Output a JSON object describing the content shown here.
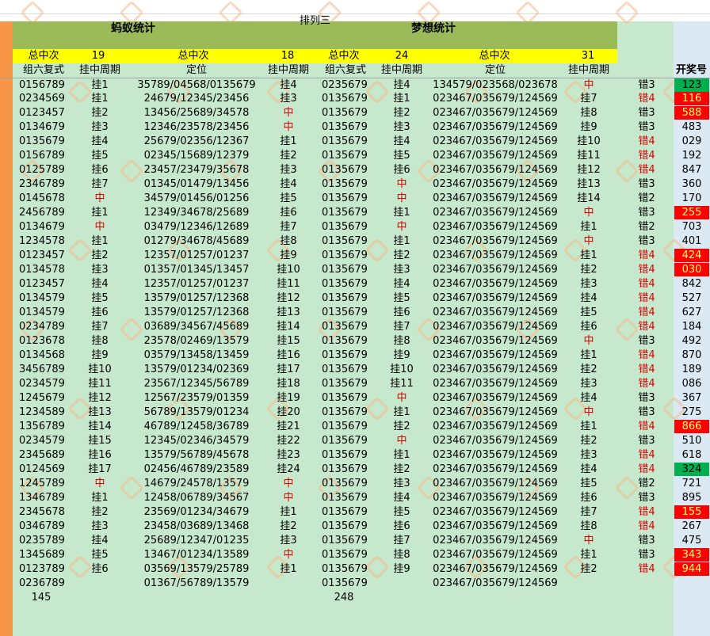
{
  "sheet": {
    "title_left": "蚂蚁统计",
    "title_right": "梦想统计",
    "subtitle": "排列三"
  },
  "summary": {
    "l1_label": "总中次",
    "l1_value": "19",
    "l2_label": "总中次",
    "l2_value": "18",
    "r1_label": "总中次",
    "r1_value": "24",
    "r2_label": "总中次",
    "r2_value": "31"
  },
  "headers": {
    "h1": "组六复式",
    "h2": "挂中周期",
    "h3": "定位",
    "h4": "挂中周期",
    "h5": "组六复式",
    "h6": "挂中周期",
    "h7": "定位",
    "h8": "挂中周期",
    "h9": "开奖号"
  },
  "rows": [
    {
      "a": "0156789",
      "b": "挂1",
      "c": "35789/04568/0135679",
      "d": "挂4",
      "e": "0235679",
      "f": "挂4",
      "g": "134579/023568/023678",
      "h": "中",
      "i": "错3",
      "j": "123",
      "jc": "green"
    },
    {
      "a": "0234569",
      "b": "挂1",
      "c": "24679/12345/23456",
      "d": "挂3",
      "e": "0135679",
      "f": "挂1",
      "g": "023467/035679/124569",
      "h": "挂7",
      "i": "错4",
      "j": "116",
      "jc": "red"
    },
    {
      "a": "0123457",
      "b": "挂2",
      "c": "13456/25689/34578",
      "d": "中",
      "e": "0135679",
      "f": "挂2",
      "g": "023467/035679/124569",
      "h": "挂8",
      "i": "错3",
      "j": "588",
      "jc": "red"
    },
    {
      "a": "0134679",
      "b": "挂3",
      "c": "12346/23578/23456",
      "d": "中",
      "e": "0135679",
      "f": "挂3",
      "g": "023467/035679/124569",
      "h": "挂9",
      "i": "错3",
      "j": "483",
      "jc": ""
    },
    {
      "a": "0135679",
      "b": "挂4",
      "c": "25679/02356/12367",
      "d": "挂1",
      "e": "0135679",
      "f": "挂4",
      "g": "023467/035679/124569",
      "h": "挂10",
      "i": "错4",
      "j": "029",
      "jc": ""
    },
    {
      "a": "0156789",
      "b": "挂5",
      "c": "02345/15689/12379",
      "d": "挂2",
      "e": "0135679",
      "f": "挂5",
      "g": "023467/035679/124569",
      "h": "挂11",
      "i": "错4",
      "j": "192",
      "jc": ""
    },
    {
      "a": "0125789",
      "b": "挂6",
      "c": "23457/23479/35678",
      "d": "挂3",
      "e": "0135679",
      "f": "挂6",
      "g": "023467/035679/124569",
      "h": "挂12",
      "i": "错4",
      "j": "847",
      "jc": ""
    },
    {
      "a": "2346789",
      "b": "挂7",
      "c": "01345/01479/13456",
      "d": "挂4",
      "e": "0135679",
      "f": "中",
      "g": "023467/035679/124569",
      "h": "挂13",
      "i": "错3",
      "j": "360",
      "jc": ""
    },
    {
      "a": "0145678",
      "b": "中",
      "c": "34579/01456/01256",
      "d": "挂5",
      "e": "0135679",
      "f": "中",
      "g": "023467/035679/124569",
      "h": "挂14",
      "i": "错2",
      "j": "170",
      "jc": ""
    },
    {
      "a": "2456789",
      "b": "挂1",
      "c": "12349/34678/25689",
      "d": "挂6",
      "e": "0135679",
      "f": "挂1",
      "g": "023467/035679/124569",
      "h": "中",
      "i": "错3",
      "j": "255",
      "jc": "red"
    },
    {
      "a": "0134679",
      "b": "中",
      "c": "03479/12346/12689",
      "d": "挂7",
      "e": "0135679",
      "f": "中",
      "g": "023467/035679/124569",
      "h": "挂1",
      "i": "错2",
      "j": "703",
      "jc": ""
    },
    {
      "a": "1234578",
      "b": "挂1",
      "c": "01279/34678/45689",
      "d": "挂8",
      "e": "0135679",
      "f": "挂1",
      "g": "023467/035679/124569",
      "h": "中",
      "i": "错3",
      "j": "401",
      "jc": ""
    },
    {
      "a": "0123457",
      "b": "挂2",
      "c": "12357/01257/01237",
      "d": "挂9",
      "e": "0135679",
      "f": "挂2",
      "g": "023467/035679/124569",
      "h": "挂1",
      "i": "错4",
      "j": "424",
      "jc": "red"
    },
    {
      "a": "0134578",
      "b": "挂3",
      "c": "01357/01345/13457",
      "d": "挂10",
      "e": "0135679",
      "f": "挂3",
      "g": "023467/035679/124569",
      "h": "挂2",
      "i": "错4",
      "j": "030",
      "jc": "red"
    },
    {
      "a": "0123457",
      "b": "挂4",
      "c": "12357/01257/01237",
      "d": "挂11",
      "e": "0135679",
      "f": "挂4",
      "g": "023467/035679/124569",
      "h": "挂3",
      "i": "错4",
      "j": "842",
      "jc": ""
    },
    {
      "a": "0134579",
      "b": "挂5",
      "c": "13579/01257/12368",
      "d": "挂12",
      "e": "0135679",
      "f": "挂5",
      "g": "023467/035679/124569",
      "h": "挂4",
      "i": "错4",
      "j": "527",
      "jc": ""
    },
    {
      "a": "0134579",
      "b": "挂6",
      "c": "13579/01257/12368",
      "d": "挂13",
      "e": "0135679",
      "f": "挂6",
      "g": "023467/035679/124569",
      "h": "挂5",
      "i": "错4",
      "j": "627",
      "jc": ""
    },
    {
      "a": "0234789",
      "b": "挂7",
      "c": "03689/34567/45689",
      "d": "挂14",
      "e": "0135679",
      "f": "挂7",
      "g": "023467/035679/124569",
      "h": "挂6",
      "i": "错4",
      "j": "184",
      "jc": ""
    },
    {
      "a": "0123678",
      "b": "挂8",
      "c": "23578/02469/13579",
      "d": "挂15",
      "e": "0135679",
      "f": "挂8",
      "g": "023467/035679/124569",
      "h": "中",
      "i": "错3",
      "j": "492",
      "jc": ""
    },
    {
      "a": "0134568",
      "b": "挂9",
      "c": "03579/13458/13459",
      "d": "挂16",
      "e": "0135679",
      "f": "挂9",
      "g": "023467/035679/124569",
      "h": "挂1",
      "i": "错4",
      "j": "870",
      "jc": ""
    },
    {
      "a": "3456789",
      "b": "挂10",
      "c": "13579/01234/02369",
      "d": "挂17",
      "e": "0135679",
      "f": "挂10",
      "g": "023467/035679/124569",
      "h": "挂2",
      "i": "错4",
      "j": "189",
      "jc": ""
    },
    {
      "a": "0234579",
      "b": "挂11",
      "c": "23567/12345/56789",
      "d": "挂18",
      "e": "0135679",
      "f": "挂11",
      "g": "023467/035679/124569",
      "h": "挂3",
      "i": "错4",
      "j": "086",
      "jc": ""
    },
    {
      "a": "1245679",
      "b": "挂12",
      "c": "12567/23579/01359",
      "d": "挂19",
      "e": "0135679",
      "f": "中",
      "g": "023467/035679/124569",
      "h": "挂4",
      "i": "错3",
      "j": "367",
      "jc": ""
    },
    {
      "a": "1234589",
      "b": "挂13",
      "c": "56789/13579/01234",
      "d": "挂20",
      "e": "0135679",
      "f": "挂1",
      "g": "023467/035679/124569",
      "h": "中",
      "i": "错3",
      "j": "275",
      "jc": ""
    },
    {
      "a": "1356789",
      "b": "挂14",
      "c": "46789/12458/36789",
      "d": "挂21",
      "e": "0135679",
      "f": "挂2",
      "g": "023467/035679/124569",
      "h": "挂1",
      "i": "错4",
      "j": "866",
      "jc": "red"
    },
    {
      "a": "0234579",
      "b": "挂15",
      "c": "12345/02346/34579",
      "d": "挂22",
      "e": "0135679",
      "f": "中",
      "g": "023467/035679/124569",
      "h": "挂2",
      "i": "错3",
      "j": "510",
      "jc": ""
    },
    {
      "a": "2345689",
      "b": "挂16",
      "c": "13579/56789/45678",
      "d": "挂23",
      "e": "0135679",
      "f": "挂1",
      "g": "023467/035679/124569",
      "h": "挂3",
      "i": "错4",
      "j": "618",
      "jc": ""
    },
    {
      "a": "0124569",
      "b": "挂17",
      "c": "02456/46789/23589",
      "d": "挂24",
      "e": "0135679",
      "f": "挂2",
      "g": "023467/035679/124569",
      "h": "挂4",
      "i": "错4",
      "j": "324",
      "jc": "green"
    },
    {
      "a": "1245789",
      "b": "中",
      "c": "14679/24578/13579",
      "d": "中",
      "e": "0135679",
      "f": "挂3",
      "g": "023467/035679/124569",
      "h": "挂5",
      "i": "错2",
      "j": "721",
      "jc": ""
    },
    {
      "a": "1346789",
      "b": "挂1",
      "c": "12458/06789/34567",
      "d": "中",
      "e": "0135679",
      "f": "挂4",
      "g": "023467/035679/124569",
      "h": "挂6",
      "i": "错3",
      "j": "895",
      "jc": ""
    },
    {
      "a": "2345678",
      "b": "挂2",
      "c": "23569/01234/34679",
      "d": "挂1",
      "e": "0135679",
      "f": "挂5",
      "g": "023467/035679/124569",
      "h": "挂7",
      "i": "错4",
      "j": "155",
      "jc": "red"
    },
    {
      "a": "0346789",
      "b": "挂3",
      "c": "23458/03689/13468",
      "d": "挂2",
      "e": "0135679",
      "f": "挂6",
      "g": "023467/035679/124569",
      "h": "挂8",
      "i": "错4",
      "j": "267",
      "jc": ""
    },
    {
      "a": "0235789",
      "b": "挂4",
      "c": "25689/12347/01235",
      "d": "挂3",
      "e": "0135679",
      "f": "挂7",
      "g": "023467/035679/124569",
      "h": "中",
      "i": "错3",
      "j": "475",
      "jc": ""
    },
    {
      "a": "1345689",
      "b": "挂5",
      "c": "13467/01234/13589",
      "d": "中",
      "e": "0135679",
      "f": "挂8",
      "g": "023467/035679/124569",
      "h": "挂1",
      "i": "错3",
      "j": "343",
      "jc": "red"
    },
    {
      "a": "0123789",
      "b": "挂6",
      "c": "03569/13579/25789",
      "d": "挂1",
      "e": "0135679",
      "f": "挂9",
      "g": "023467/035679/124569",
      "h": "挂2",
      "i": "错4",
      "j": "944",
      "jc": "red"
    },
    {
      "a": "0236789",
      "b": "",
      "c": "01367/56789/13579",
      "d": "",
      "e": "0135679",
      "f": "",
      "g": "023467/035679/124569",
      "h": "",
      "i": "",
      "j": "",
      "jc": ""
    }
  ],
  "footer": {
    "left_total": "145",
    "right_total": "248"
  },
  "colors": {
    "sheet_bg": "#c6e8cc",
    "title_bar": "#9bbb59",
    "summary_bar": "#ffff00",
    "left_strip": "#f79646",
    "hit_text": "#e00000",
    "draw_red": "#ff0000",
    "draw_green": "#00b050"
  }
}
